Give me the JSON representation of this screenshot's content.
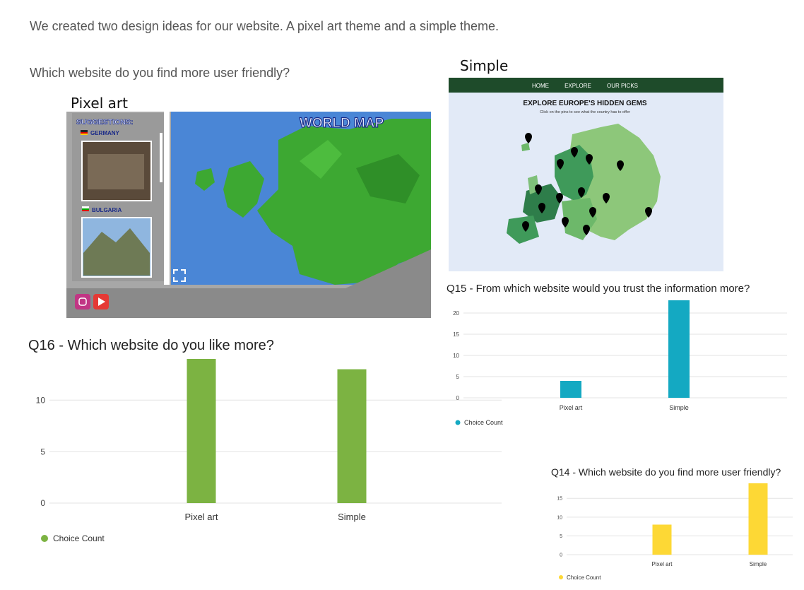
{
  "intro_text": "We created two design ideas for our website. A pixel art theme and a simple theme.",
  "question_text": "Which website do you find more user friendly?",
  "pixel_mock": {
    "caption": "Pixel art",
    "banner": "WORLD MAP",
    "suggestions_label": "SUGGESTIONS:",
    "countries": [
      "GERMANY",
      "BULGARIA"
    ]
  },
  "simple_mock": {
    "caption": "Simple",
    "nav": [
      "HOME",
      "EXPLORE",
      "OUR PICKS"
    ],
    "headline": "EXPLORE EUROPE'S HIDDEN GEMS",
    "subtitle": "Click on the pins to see what the country has to offer"
  },
  "colors": {
    "green": "#7cb342",
    "teal": "#14a9c2",
    "yellow": "#fdd835",
    "sea": "#4a86d6",
    "dark_green": "#1e4b2a"
  },
  "chart_data": [
    {
      "id": "q16",
      "type": "bar",
      "title": "Q16 - Which website do you like more?",
      "categories": [
        "Pixel art",
        "Simple"
      ],
      "series": [
        {
          "name": "Choice Count",
          "values": [
            14,
            13
          ]
        }
      ],
      "ylim": [
        0,
        14
      ],
      "yticks": [
        0,
        5,
        10
      ],
      "color": "#7cb342",
      "legend": "bottom-left",
      "grid": true
    },
    {
      "id": "q15",
      "type": "bar",
      "title": "Q15 - From which website would you trust the information more?",
      "categories": [
        "Pixel art",
        "Simple"
      ],
      "series": [
        {
          "name": "Choice Count",
          "values": [
            4,
            23
          ]
        }
      ],
      "ylim": [
        0,
        23
      ],
      "yticks": [
        0,
        5,
        10,
        15,
        20
      ],
      "color": "#14a9c2",
      "legend": "bottom-left",
      "grid": true
    },
    {
      "id": "q14",
      "type": "bar",
      "title": "Q14 - Which website do you find more user friendly?",
      "categories": [
        "Pixel art",
        "Simple"
      ],
      "series": [
        {
          "name": "Choice Count",
          "values": [
            8,
            19
          ]
        }
      ],
      "ylim": [
        0,
        19
      ],
      "yticks": [
        0,
        5,
        10,
        15
      ],
      "color": "#fdd835",
      "legend": "bottom-left",
      "grid": true
    }
  ]
}
